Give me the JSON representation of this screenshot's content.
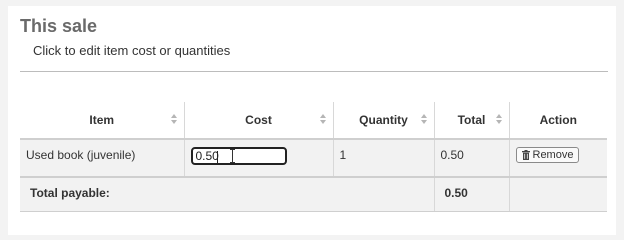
{
  "section": {
    "title": "This sale",
    "subtitle": "Click to edit item cost or quantities"
  },
  "table": {
    "headers": [
      "Item",
      "Cost",
      "Quantity",
      "Total",
      "Action"
    ],
    "rows": [
      {
        "item": "Used book (juvenile)",
        "cost_value": "0.50",
        "quantity": "1",
        "total": "0.50",
        "action_label": "Remove",
        "action_icon": "trash-icon"
      }
    ],
    "footer": {
      "label": "Total payable:",
      "total": "0.50"
    }
  }
}
